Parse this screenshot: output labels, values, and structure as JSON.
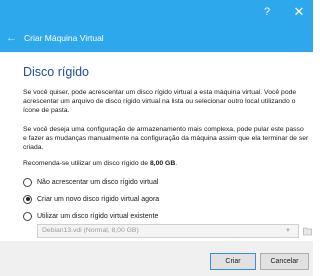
{
  "window": {
    "help_icon": "?",
    "close_icon": "✕"
  },
  "nav": {
    "back_icon": "←",
    "title": "Criar Máquina Virtual"
  },
  "page": {
    "title": "Disco rígido",
    "paragraph1": "Se você quiser, pode acrescentar um disco rígido virtual a esta máquina virtual. Você pode acrescentar um arquivo de disco rígido virtual na lista ou selecionar outro local utilizando o ícone de pasta.",
    "paragraph2": "Se você deseja uma configuração de armazenamento mais complexa, pode pular este passo e fazer as mudanças manualmente na configuração da máquina assim que ela terminar de ser criada.",
    "recommend_prefix": "Recomenda-se utilizar um disco rígido de ",
    "recommend_size": "8,00 GB",
    "recommend_suffix": "."
  },
  "options": {
    "no_disk": "Não acrescentar um disco rígido virtual",
    "create_new": "Criar um novo disco rígido virtual agora",
    "use_existing": "Utilizar um disco rígido virtual existente",
    "selected": "create_new"
  },
  "existing_disk": {
    "value": "Debian13.vdi (Normal, 8,00 GB)",
    "arrow_icon": "▼"
  },
  "buttons": {
    "create": "Criar",
    "cancel": "Cancelar"
  },
  "colors": {
    "accent": "#2ea8ed",
    "title_text": "#1f4ea0"
  }
}
